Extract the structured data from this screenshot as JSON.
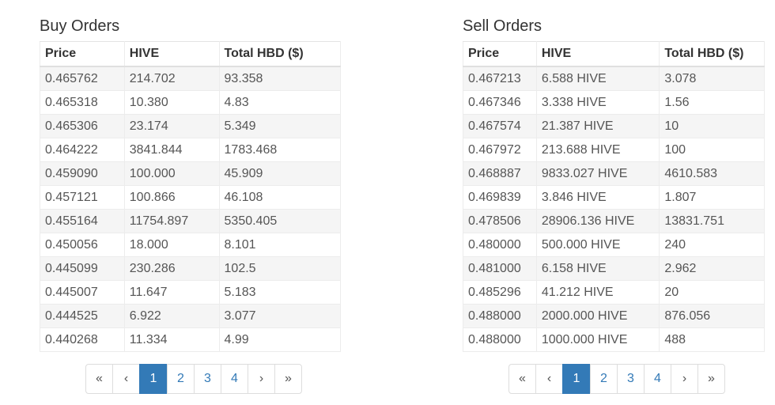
{
  "buy": {
    "title": "Buy Orders",
    "headers": [
      "Price",
      "HIVE",
      "Total HBD ($)"
    ],
    "rows": [
      [
        "0.465762",
        "214.702",
        "93.358"
      ],
      [
        "0.465318",
        "10.380",
        "4.83"
      ],
      [
        "0.465306",
        "23.174",
        "5.349"
      ],
      [
        "0.464222",
        "3841.844",
        "1783.468"
      ],
      [
        "0.459090",
        "100.000",
        "45.909"
      ],
      [
        "0.457121",
        "100.866",
        "46.108"
      ],
      [
        "0.455164",
        "11754.897",
        "5350.405"
      ],
      [
        "0.450056",
        "18.000",
        "8.101"
      ],
      [
        "0.445099",
        "230.286",
        "102.5"
      ],
      [
        "0.445007",
        "11.647",
        "5.183"
      ],
      [
        "0.444525",
        "6.922",
        "3.077"
      ],
      [
        "0.440268",
        "11.334",
        "4.99"
      ]
    ]
  },
  "sell": {
    "title": "Sell Orders",
    "headers": [
      "Price",
      "HIVE",
      "Total HBD ($)"
    ],
    "rows": [
      [
        "0.467213",
        "6.588 HIVE",
        "3.078"
      ],
      [
        "0.467346",
        "3.338 HIVE",
        "1.56"
      ],
      [
        "0.467574",
        "21.387 HIVE",
        "10"
      ],
      [
        "0.467972",
        "213.688 HIVE",
        "100"
      ],
      [
        "0.468887",
        "9833.027 HIVE",
        "4610.583"
      ],
      [
        "0.469839",
        "3.846 HIVE",
        "1.807"
      ],
      [
        "0.478506",
        "28906.136 HIVE",
        "13831.751"
      ],
      [
        "0.480000",
        "500.000 HIVE",
        "240"
      ],
      [
        "0.481000",
        "6.158 HIVE",
        "2.962"
      ],
      [
        "0.485296",
        "41.212 HIVE",
        "20"
      ],
      [
        "0.488000",
        "2000.000 HIVE",
        "876.056"
      ],
      [
        "0.488000",
        "1000.000 HIVE",
        "488"
      ]
    ]
  },
  "pagination": {
    "first": "«",
    "prev": "‹",
    "pages": [
      "1",
      "2",
      "3",
      "4"
    ],
    "active_page": "1",
    "next": "›",
    "last": "»"
  },
  "colors": {
    "accent": "#337ab7",
    "stripe": "#f5f5f5",
    "border": "#ececec"
  }
}
